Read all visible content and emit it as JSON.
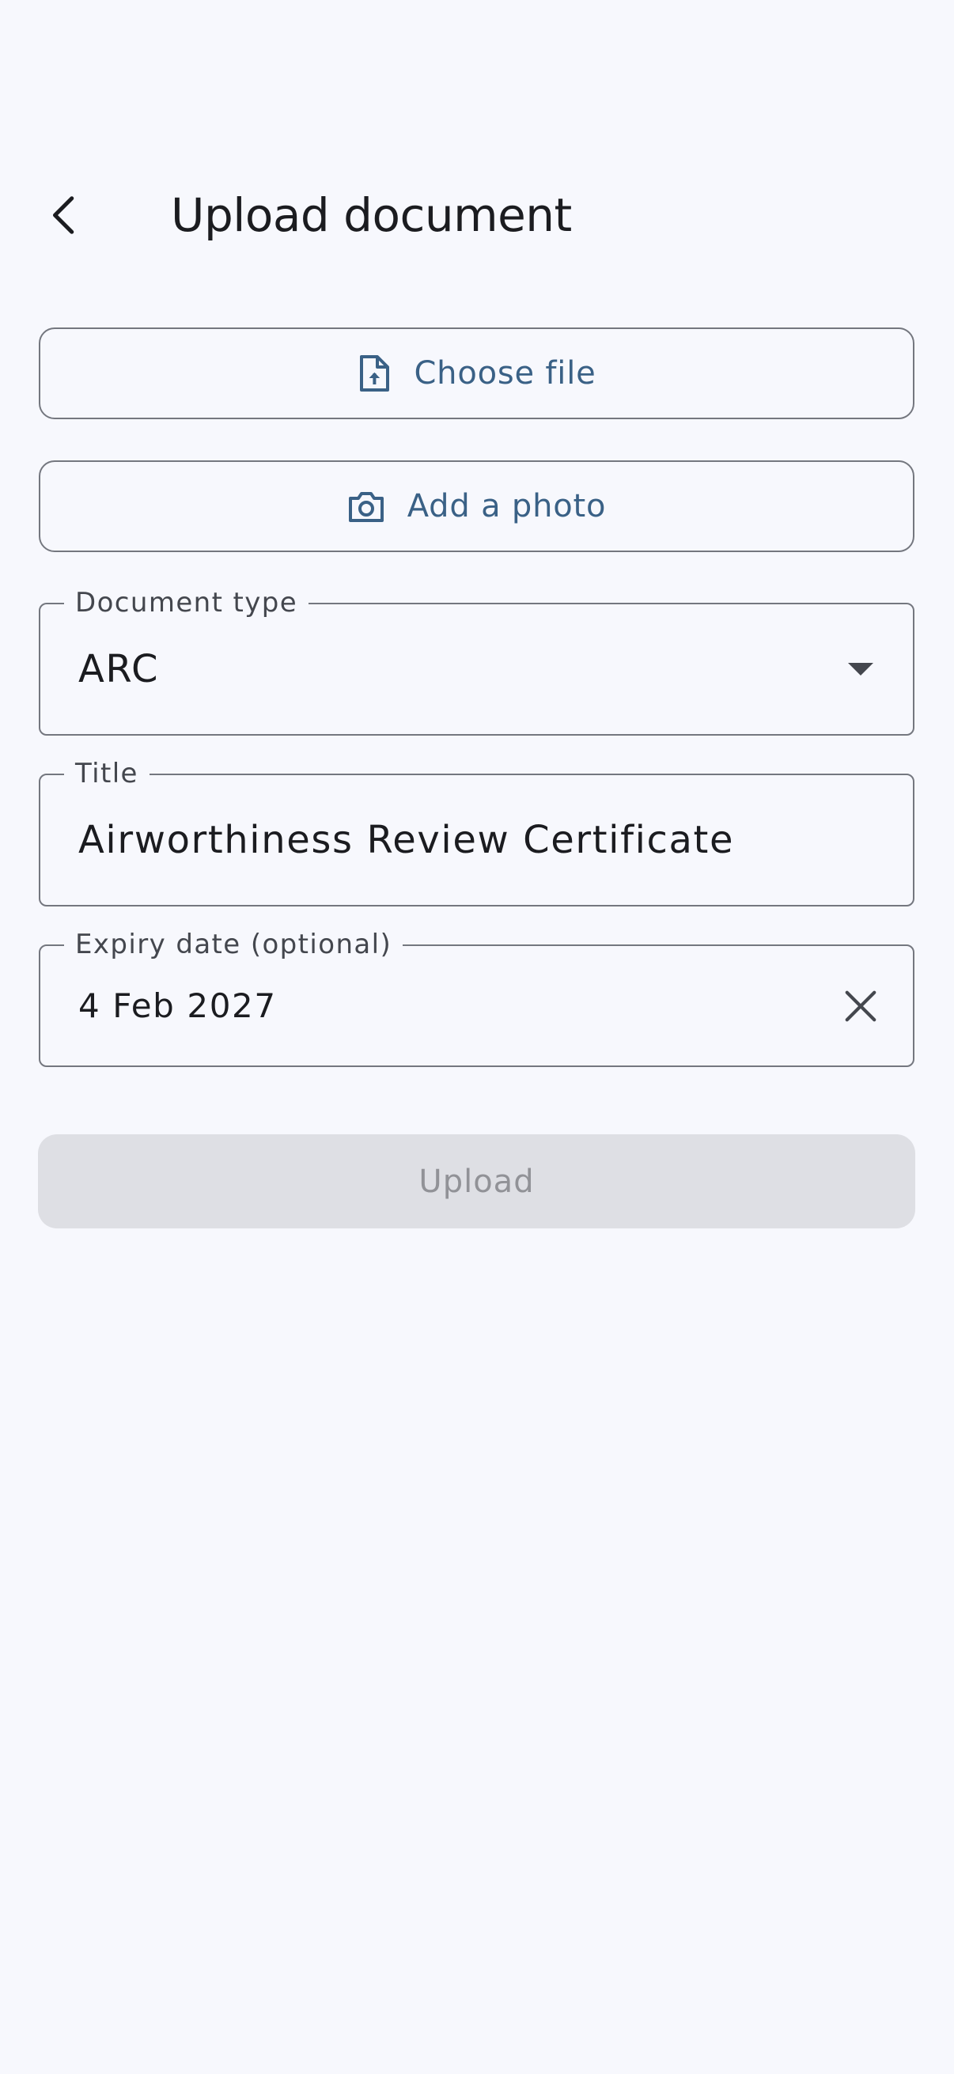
{
  "header": {
    "title": "Upload document"
  },
  "actions": {
    "choose_file": {
      "label": "Choose file",
      "icon": "file-upload-icon"
    },
    "add_photo": {
      "label": "Add a photo",
      "icon": "camera-icon"
    }
  },
  "form": {
    "document_type": {
      "label": "Document type",
      "value": "ARC",
      "icon": "dropdown-arrow-icon"
    },
    "title": {
      "label": "Title",
      "value": "Airworthiness Review Certificate"
    },
    "expiry_date": {
      "label": "Expiry date (optional)",
      "value": "4 Feb 2027",
      "icon": "clear-icon"
    }
  },
  "submit": {
    "label": "Upload",
    "enabled": false
  },
  "colors": {
    "background": "#f7f8fd",
    "accent": "#3a6186",
    "outline": "#74777f",
    "disabled_bg": "#dedfe4",
    "disabled_text": "#919297"
  }
}
